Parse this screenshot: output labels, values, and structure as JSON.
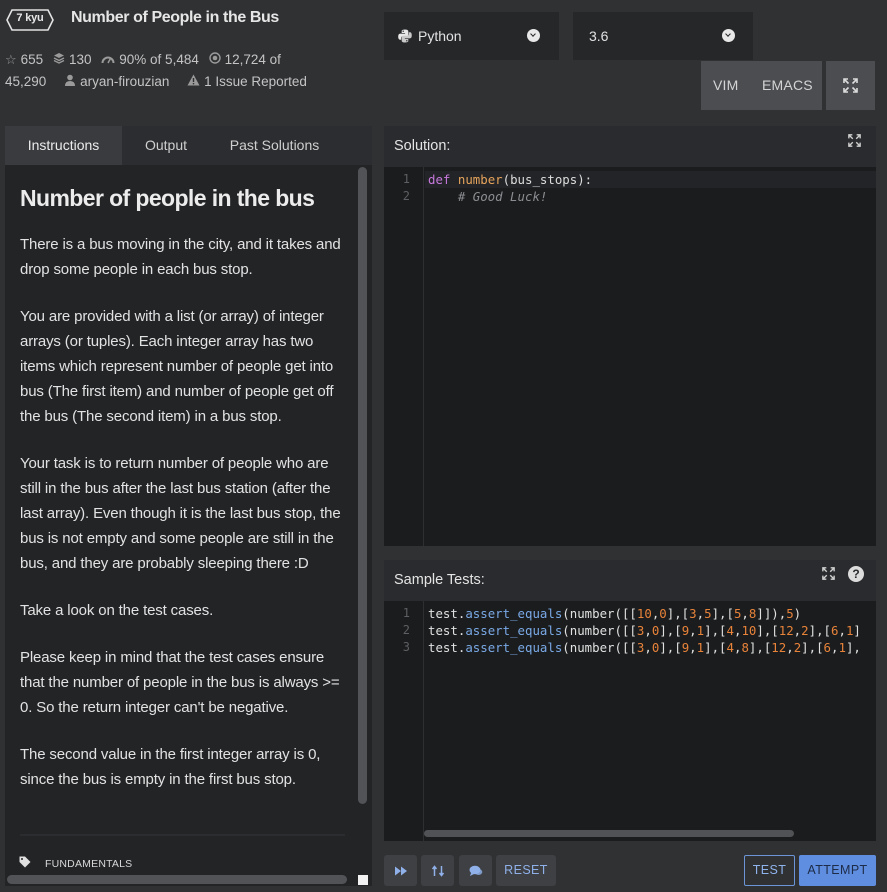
{
  "header": {
    "rank": "7 kyu",
    "title": "Number of People in the Bus",
    "stats": {
      "stars": "655",
      "collections": "130",
      "satisfaction": "90%",
      "satisfaction_suffix": "of 5,484",
      "completed": "12,724",
      "completed_suffix": "of",
      "total": "45,290",
      "author": "aryan-firouzian",
      "issues": "1 Issue Reported"
    }
  },
  "language_select": {
    "value": "Python",
    "icon": "python-logo-icon"
  },
  "version_select": {
    "value": "3.6"
  },
  "keybindings": {
    "vim": "VIM",
    "emacs": "EMACS"
  },
  "left_panel": {
    "tabs": [
      {
        "label": "Instructions",
        "active": true
      },
      {
        "label": "Output",
        "active": false
      },
      {
        "label": "Past Solutions",
        "active": false
      }
    ],
    "heading": "Number of people in the bus",
    "paragraphs": [
      "There is a bus moving in the city, and it takes and drop some people in each bus stop.",
      "You are provided with a list (or array) of integer arrays (or tuples). Each integer array has two items which represent number of people get into bus (The first item) and number of people get off the bus (The second item) in a bus stop.",
      "Your task is to return number of people who are still in the bus after the last bus station (after the last array). Even though it is the last bus stop, the bus is not empty and some people are still in the bus, and they are probably sleeping there :D",
      "Take a look on the test cases.",
      "Please keep in mind that the test cases ensure that the number of people in the bus is always >= 0. So the return integer can't be negative.",
      "The second value in the first integer array is 0, since the bus is empty in the first bus stop."
    ],
    "tag": "FUNDAMENTALS"
  },
  "solution": {
    "label": "Solution:",
    "line_numbers": [
      "1",
      "2"
    ],
    "code_lines": [
      "def number(bus_stops):",
      "    # Good Luck!"
    ]
  },
  "sample_tests": {
    "label": "Sample Tests:",
    "line_numbers": [
      "1",
      "2",
      "3"
    ],
    "code_lines": [
      "test.assert_equals(number([[10,0],[3,5],[5,8]]),5)",
      "test.assert_equals(number([[3,0],[9,1],[4,10],[12,2],[6,1]",
      "test.assert_equals(number([[3,0],[9,1],[4,8],[12,2],[6,1],"
    ]
  },
  "toolbar": {
    "reset": "RESET",
    "test": "TEST",
    "attempt": "ATTEMPT"
  },
  "colors": {
    "accent": "#5f8ee0",
    "background": "#303133",
    "panel": "#2a2b2e",
    "editor": "#1b1c1d"
  }
}
